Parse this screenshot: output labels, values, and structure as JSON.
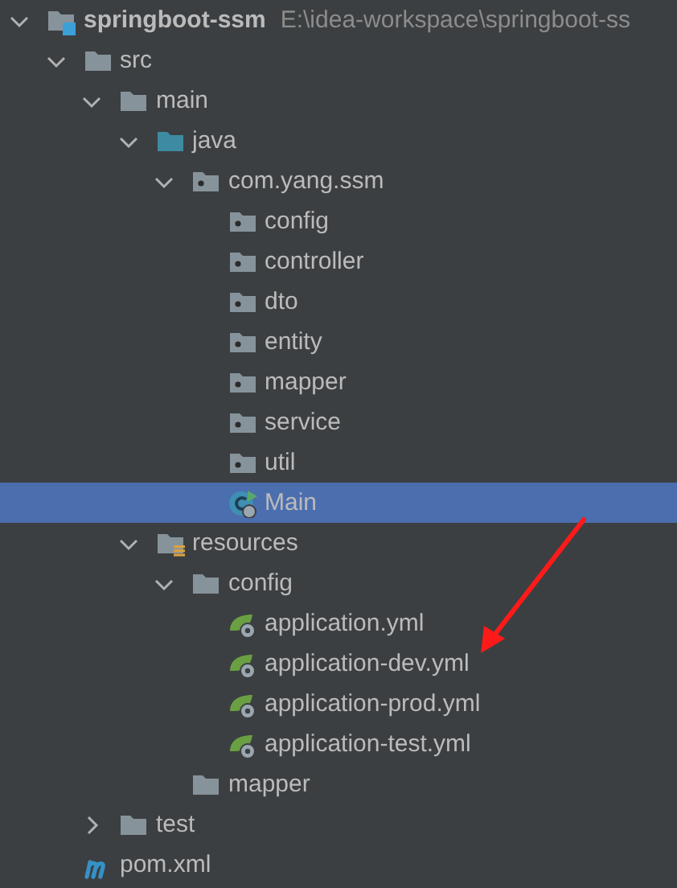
{
  "tree": {
    "items": [
      {
        "label": "springboot-ssm",
        "note": "E:\\idea-workspace\\springboot-ss",
        "kind": "module",
        "expanded": true,
        "selected": false,
        "children": [
          {
            "label": "src",
            "kind": "folder",
            "expanded": true,
            "selected": false,
            "children": [
              {
                "label": "main",
                "kind": "folder",
                "expanded": true,
                "selected": false,
                "children": [
                  {
                    "label": "java",
                    "kind": "source",
                    "expanded": true,
                    "selected": false,
                    "children": [
                      {
                        "label": "com.yang.ssm",
                        "kind": "package",
                        "expanded": true,
                        "selected": false,
                        "children": [
                          {
                            "label": "config",
                            "kind": "package",
                            "selected": false
                          },
                          {
                            "label": "controller",
                            "kind": "package",
                            "selected": false
                          },
                          {
                            "label": "dto",
                            "kind": "package",
                            "selected": false
                          },
                          {
                            "label": "entity",
                            "kind": "package",
                            "selected": false
                          },
                          {
                            "label": "mapper",
                            "kind": "package",
                            "selected": false
                          },
                          {
                            "label": "service",
                            "kind": "package",
                            "selected": false
                          },
                          {
                            "label": "util",
                            "kind": "package",
                            "selected": false
                          },
                          {
                            "label": "Main",
                            "kind": "class",
                            "selected": true
                          }
                        ]
                      }
                    ]
                  },
                  {
                    "label": "resources",
                    "kind": "resources",
                    "expanded": true,
                    "selected": false,
                    "children": [
                      {
                        "label": "config",
                        "kind": "folder",
                        "expanded": true,
                        "selected": false,
                        "children": [
                          {
                            "label": "application.yml",
                            "kind": "spring",
                            "selected": false
                          },
                          {
                            "label": "application-dev.yml",
                            "kind": "spring",
                            "selected": false
                          },
                          {
                            "label": "application-prod.yml",
                            "kind": "spring",
                            "selected": false
                          },
                          {
                            "label": "application-test.yml",
                            "kind": "spring",
                            "selected": false
                          }
                        ]
                      },
                      {
                        "label": "mapper",
                        "kind": "folder",
                        "selected": false
                      }
                    ]
                  }
                ]
              },
              {
                "label": "test",
                "kind": "folder",
                "expanded": false,
                "selected": false
              }
            ]
          },
          {
            "label": "pom.xml",
            "kind": "maven",
            "selected": false
          }
        ]
      }
    ]
  }
}
